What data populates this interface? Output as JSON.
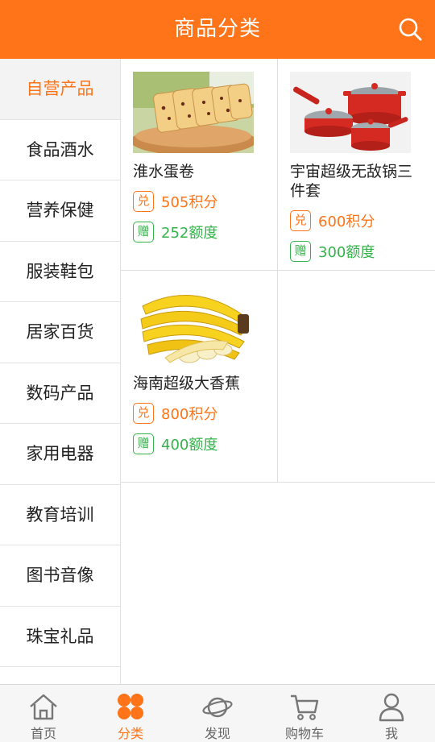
{
  "header": {
    "title": "商品分类",
    "search_icon": "search-icon"
  },
  "sidebar": {
    "items": [
      {
        "label": "自营产品",
        "active": true
      },
      {
        "label": "食品酒水"
      },
      {
        "label": "营养保健"
      },
      {
        "label": "服装鞋包"
      },
      {
        "label": "居家百货"
      },
      {
        "label": "数码产品"
      },
      {
        "label": "家用电器"
      },
      {
        "label": "教育培训"
      },
      {
        "label": "图书音像"
      },
      {
        "label": "珠宝礼品"
      }
    ]
  },
  "products": [
    {
      "name": "淮水蛋卷",
      "exchange_tag": "兑",
      "points": "505积分",
      "gift_tag": "赠",
      "quota": "252额度",
      "image": "cake-roll-image"
    },
    {
      "name": "宇宙超级无敌锅三件套",
      "exchange_tag": "兑",
      "points": "600积分",
      "gift_tag": "赠",
      "quota": "300额度",
      "image": "red-pot-set-image"
    },
    {
      "name": "海南超级大香蕉",
      "exchange_tag": "兑",
      "points": "800积分",
      "gift_tag": "赠",
      "quota": "400额度",
      "image": "banana-image"
    }
  ],
  "tabbar": {
    "items": [
      {
        "label": "首页",
        "icon": "home-icon"
      },
      {
        "label": "分类",
        "icon": "category-icon",
        "active": true
      },
      {
        "label": "发现",
        "icon": "discover-icon"
      },
      {
        "label": "购物车",
        "icon": "cart-icon"
      },
      {
        "label": "我",
        "icon": "profile-icon"
      }
    ]
  },
  "colors": {
    "accent": "#ff7418",
    "green": "#34b34a",
    "sidebar_active_bg": "#f3f3f3"
  }
}
